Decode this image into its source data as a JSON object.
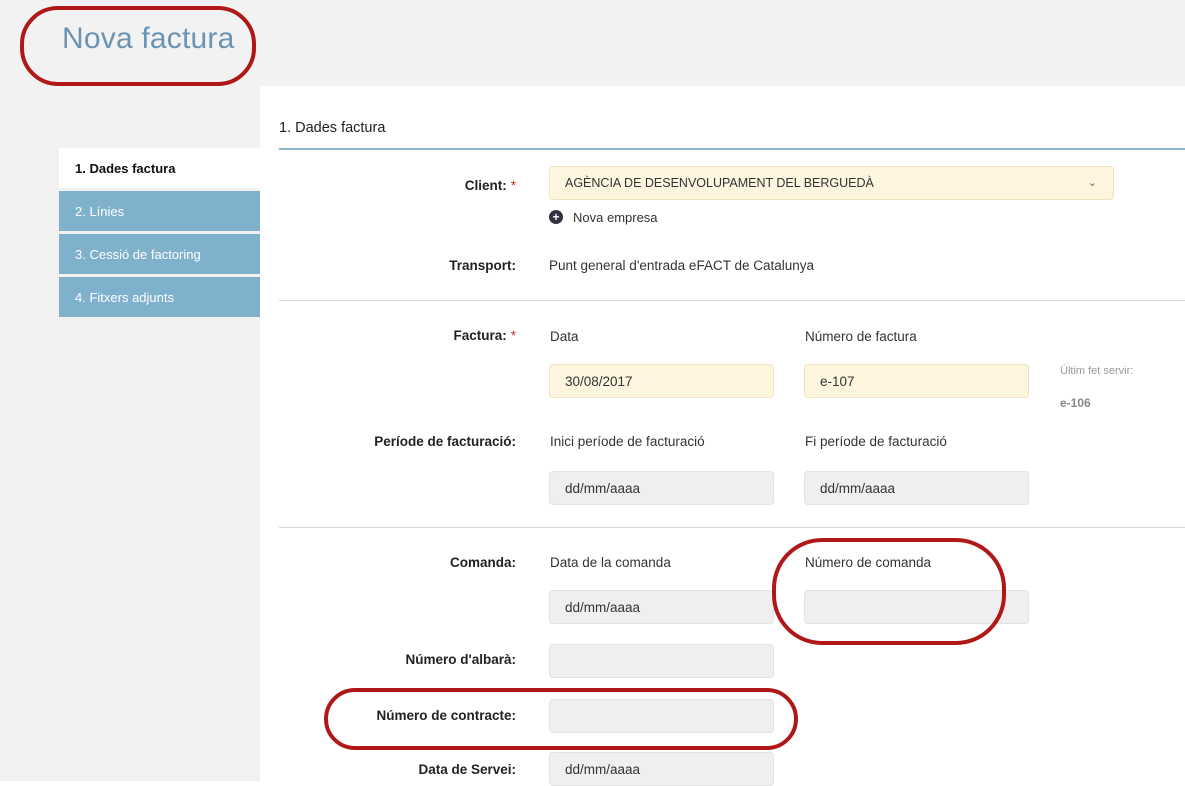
{
  "page": {
    "title": "Nova factura"
  },
  "tabs": [
    {
      "label": "1. Dades factura"
    },
    {
      "label": "2. Línies"
    },
    {
      "label": "3. Cessió de factoring"
    },
    {
      "label": "4. Fitxers adjunts"
    }
  ],
  "section": {
    "title": "1. Dades factura"
  },
  "client": {
    "label": "Client:",
    "required_mark": "*",
    "value": "AGÈNCIA DE DESENVOLUPAMENT DEL BERGUEDÀ",
    "new_company_label": "Nova empresa"
  },
  "transport": {
    "label": "Transport:",
    "value": "Punt general d'entrada eFACT de Catalunya"
  },
  "invoice": {
    "label": "Factura:",
    "required_mark": "*",
    "date_label": "Data",
    "date_value": "30/08/2017",
    "number_label": "Número de factura",
    "number_value": "e-107",
    "last_used_label": "Últim fet servir:",
    "last_used_value": "e-106"
  },
  "billing_period": {
    "label": "Període de facturació:",
    "start_label": "Inici període de facturació",
    "start_placeholder": "dd/mm/aaaa",
    "end_label": "Fi període de facturació",
    "end_placeholder": "dd/mm/aaaa"
  },
  "order": {
    "label": "Comanda:",
    "date_label": "Data de la comanda",
    "date_placeholder": "dd/mm/aaaa",
    "number_label": "Número de comanda",
    "number_value": ""
  },
  "delivery_note": {
    "label": "Número d'albarà:",
    "value": ""
  },
  "contract": {
    "label": "Número de contracte:",
    "value": ""
  },
  "service_date": {
    "label": "Data de Servei:",
    "placeholder": "dd/mm/aaaa"
  },
  "colors": {
    "title": "#6b93b3",
    "tab_inactive": "#7fb0cc",
    "required": "#c0392b",
    "annotation": "#b01818",
    "required_field_bg": "#fdf5dd"
  }
}
